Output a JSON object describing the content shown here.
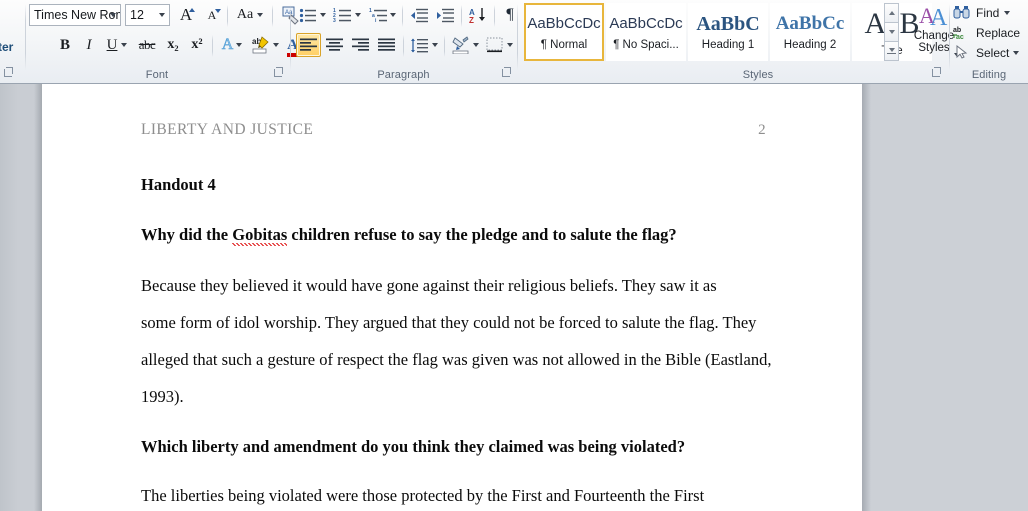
{
  "ribbon": {
    "clipboard_partial_label": "ter",
    "groups": [
      {
        "name": "Font",
        "label": "Font"
      },
      {
        "name": "Paragraph",
        "label": "Paragraph"
      },
      {
        "name": "Styles",
        "label": "Styles"
      },
      {
        "name": "Editing",
        "label": "Editing"
      }
    ],
    "font": {
      "font_name": "Times New Rom",
      "font_size": "12",
      "grow_font": "A",
      "shrink_font": "A",
      "change_case": "Aa",
      "clear_formatting": "clear-formatting-icon",
      "bold": "B",
      "italic": "I",
      "underline": "U",
      "strikethrough": "abc",
      "subscript": "x₂",
      "superscript": "x²",
      "text_effects": "A",
      "text_highlight": "ab",
      "font_color": "A"
    },
    "paragraph": {
      "bullets": "bullets-icon",
      "numbering": "numbering-icon",
      "multilevel": "multilevel-list-icon",
      "decrease_indent": "decrease-indent-icon",
      "increase_indent": "increase-indent-icon",
      "sort": "sort-icon",
      "show_marks": "¶",
      "align_left": "align-left-icon",
      "align_center": "align-center-icon",
      "align_right": "align-right-icon",
      "justify": "justify-icon",
      "line_spacing": "line-spacing-icon",
      "shading": "shading-icon",
      "borders": "borders-icon",
      "selected_alignment": "align_left"
    },
    "styles": {
      "items": [
        {
          "preview": "AaBbCcDc",
          "name": "¶ Normal",
          "selected": true
        },
        {
          "preview": "AaBbCcDc",
          "name": "¶ No Spaci...",
          "selected": false
        },
        {
          "preview": "AaBbC",
          "name": "Heading 1",
          "selected": false
        },
        {
          "preview": "AaBbCc",
          "name": "Heading 2",
          "selected": false
        },
        {
          "preview": "AaB",
          "name": "Title",
          "selected": false
        }
      ],
      "change_styles": "Change\nStyles",
      "change_styles_line1": "Change",
      "change_styles_line2": "Styles"
    },
    "editing": {
      "find": "Find",
      "replace": "Replace",
      "select": "Select"
    }
  },
  "document": {
    "header_text": "LIBERTY AND JUSTICE",
    "page_number": "2",
    "paragraphs": [
      {
        "kind": "bold",
        "text": "Handout 4"
      },
      {
        "kind": "bold-spell",
        "pre": "Why did the ",
        "misspelled": "Gobitas",
        "post": " children refuse to say the pledge and to salute the flag?"
      },
      {
        "kind": "body",
        "text": "            Because they believed it would have gone against their religious beliefs. They saw it as"
      },
      {
        "kind": "body",
        "text": "some form of idol worship. They argued that they could not be forced to salute the flag. They"
      },
      {
        "kind": "body",
        "text": "alleged that such a gesture of respect the flag was given was not allowed in the Bible (Eastland,"
      },
      {
        "kind": "body",
        "text": "1993)."
      },
      {
        "kind": "bold",
        "text": "Which liberty and amendment do you think they claimed was being violated?"
      },
      {
        "kind": "body",
        "text": "            The liberties being violated were those protected by the First and Fourteenth the First"
      }
    ]
  },
  "colors": {
    "ribbon_bg": "#f3f5f7",
    "group_label": "#5a6676",
    "selected_highlight": "#ffcf63",
    "style_selected_border": "#e8b63c",
    "doc_background": "#c8ccd2",
    "page": "#ffffff",
    "header_gray": "#8e8e8e",
    "spelling_error": "#e01b1b",
    "font_color_swatch": "#cc0000",
    "highlight_swatch": "#ffff00"
  }
}
